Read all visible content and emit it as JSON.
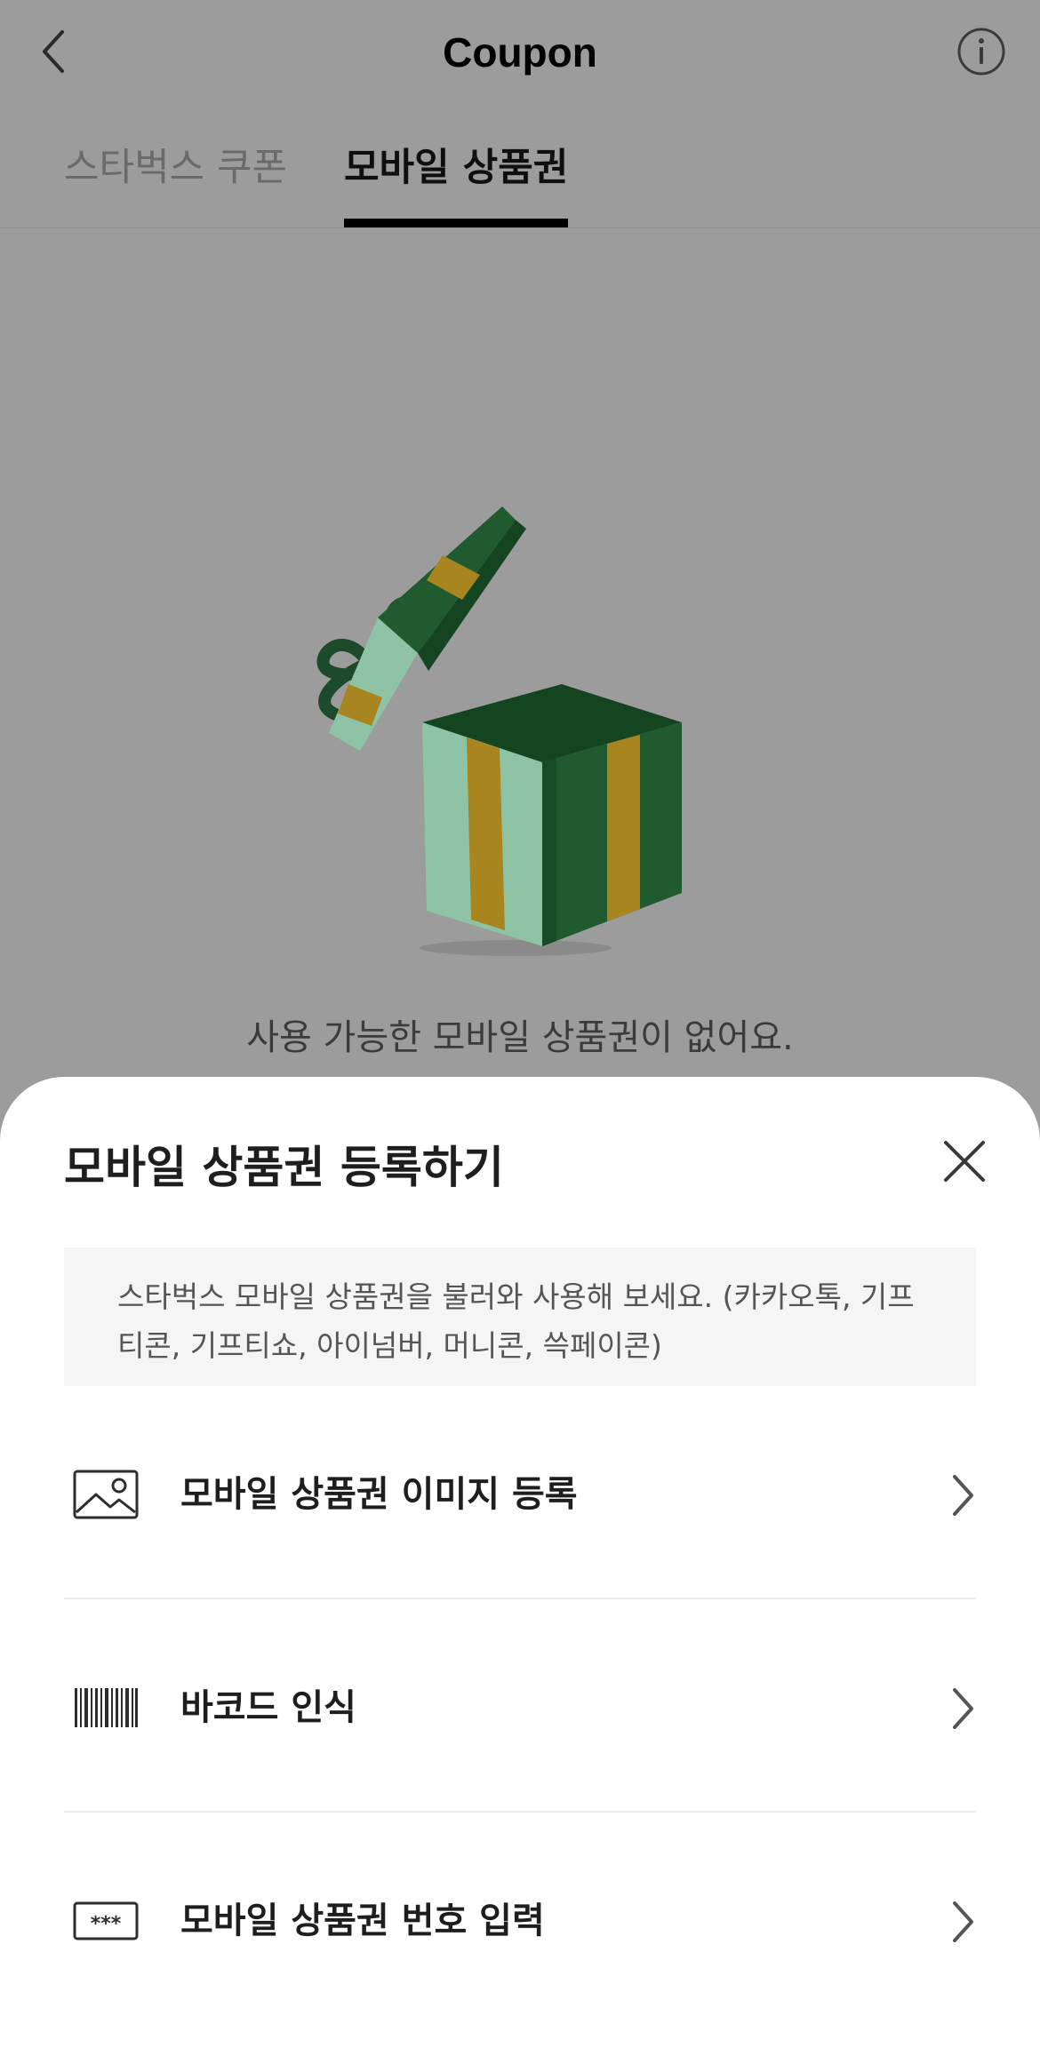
{
  "header": {
    "title": "Coupon",
    "back_icon": "chevron-left-icon",
    "info_icon": "info-circle-icon"
  },
  "tabs": [
    {
      "label": "스타벅스 쿠폰",
      "active": false
    },
    {
      "label": "모바일 상품권",
      "active": true
    }
  ],
  "empty_state": {
    "illustration": "open-gift-box-illustration",
    "message": "사용 가능한 모바일 상품권이 없어요."
  },
  "sheet": {
    "title": "모바일 상품권 등록하기",
    "close_icon": "close-icon",
    "notice_line1": "스타벅스 모바일 상품권을 불러와 사용해 보세요. (카카오톡, 기프",
    "notice_line2": "티콘, 기프티쇼, 아이넘버, 머니콘, 쓱페이콘)",
    "items": [
      {
        "label": "모바일 상품권 이미지 등록",
        "icon": "image-icon"
      },
      {
        "label": "바코드 인식",
        "icon": "barcode-icon"
      },
      {
        "label": "모바일 상품권 번호 입력",
        "icon": "code-number-icon",
        "icon_text": "***"
      }
    ]
  },
  "colors": {
    "brand_green": "#1f5b2e",
    "mint": "#8fc3a5",
    "ribbon_gold": "#a8851f",
    "overlay": "#9c9c9c"
  }
}
